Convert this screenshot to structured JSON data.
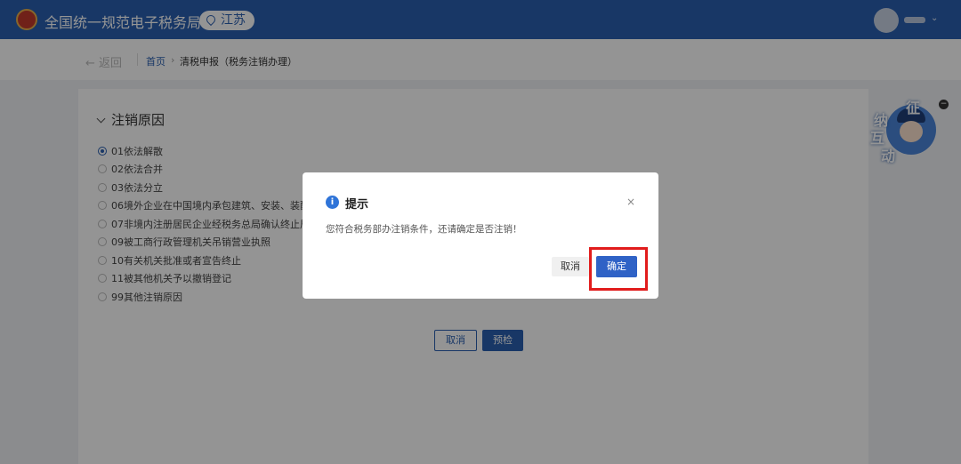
{
  "header": {
    "title": "全国统一规范电子税务局",
    "region": "江苏",
    "user_name": ""
  },
  "breadcrumb": {
    "back_label": "← 返回",
    "home": "首页",
    "separator": "›",
    "current": "清税申报（税务注销办理）"
  },
  "section": {
    "title": "注销原因",
    "reasons": [
      {
        "label": "01依法解散",
        "selected": true
      },
      {
        "label": "02依法合并",
        "selected": false
      },
      {
        "label": "03依法分立",
        "selected": false
      },
      {
        "label": "06境外企业在中国境内承包建筑、安装、装配",
        "selected": false
      },
      {
        "label": "07非境内注册居民企业经税务总局确认终止居",
        "selected": false
      },
      {
        "label": "09被工商行政管理机关吊销营业执照",
        "selected": false
      },
      {
        "label": "10有关机关批准或者宣告终止",
        "selected": false
      },
      {
        "label": "11被其他机关予以撤销登记",
        "selected": false
      },
      {
        "label": "99其他注销原因",
        "selected": false
      }
    ]
  },
  "page_buttons": {
    "cancel": "取消",
    "precheck": "预检"
  },
  "mascot": {
    "chars": [
      "征",
      "纳",
      "互",
      "动"
    ],
    "close": "−"
  },
  "dialog": {
    "icon": "i",
    "title": "提示",
    "close": "×",
    "message": "您符合税务部办注销条件，还请确定是否注销！",
    "cancel": "取消",
    "confirm": "确定"
  },
  "colors": {
    "header_blue": "#2a5fb0",
    "primary": "#2f62c6",
    "highlight_red": "#e11c1c"
  }
}
